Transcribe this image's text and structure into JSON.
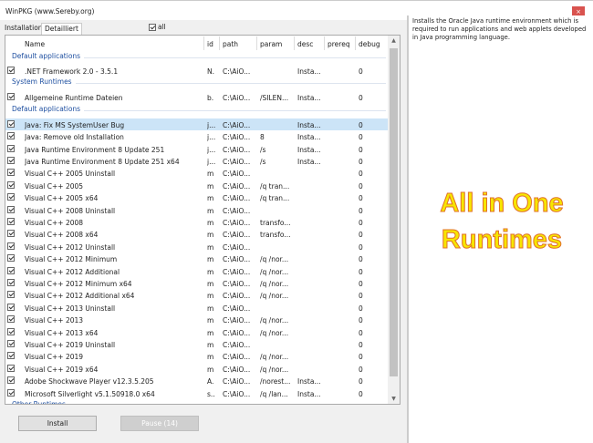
{
  "window": {
    "title": "WinPKG (www.Sereby.org)",
    "close": "×"
  },
  "tabs": [
    {
      "label": "Installation",
      "active": false
    },
    {
      "label": "Detailliert",
      "active": true
    }
  ],
  "all_checkbox": {
    "label": "all",
    "checked": true
  },
  "columns": [
    "Name",
    "id",
    "path",
    "param",
    "desc",
    "prereq",
    "debug"
  ],
  "items": [
    {
      "group": "Default applications"
    },
    {
      "name": ".NET Framework 2.0 - 3.5.1",
      "id": "N.",
      "path": "C:\\AiO...",
      "param": "",
      "desc": "Insta...",
      "prereq": "",
      "debug": "0"
    },
    {
      "group": "System Runtimes"
    },
    {
      "name": "Allgemeine Runtime Dateien",
      "id": "b.",
      "path": "C:\\AiO...",
      "param": "/SILEN...",
      "desc": "Insta...",
      "prereq": "",
      "debug": "0"
    },
    {
      "group": "Default applications"
    },
    {
      "name": "Java: Fix MS SystemUser Bug",
      "id": "j...",
      "path": "C:\\AiO...",
      "param": "",
      "desc": "Insta...",
      "prereq": "",
      "debug": "0",
      "selected": true
    },
    {
      "name": "Java: Remove old Installation",
      "id": "j...",
      "path": "C:\\AiO...",
      "param": "8",
      "desc": "Insta...",
      "prereq": "",
      "debug": "0"
    },
    {
      "name": "Java Runtime Environment 8 Update 251",
      "id": "j...",
      "path": "C:\\AiO...",
      "param": "/s",
      "desc": "Insta...",
      "prereq": "",
      "debug": "0"
    },
    {
      "name": "Java Runtime Environment 8 Update 251 x64",
      "id": "j...",
      "path": "C:\\AiO...",
      "param": "/s",
      "desc": "Insta...",
      "prereq": "",
      "debug": "0"
    },
    {
      "name": "Visual C++ 2005 Uninstall",
      "id": "m",
      "path": "C:\\AiO...",
      "param": "",
      "desc": "",
      "prereq": "",
      "debug": "0"
    },
    {
      "name": "Visual C++ 2005",
      "id": "m",
      "path": "C:\\AiO...",
      "param": "/q tran...",
      "desc": "",
      "prereq": "",
      "debug": "0"
    },
    {
      "name": "Visual C++ 2005 x64",
      "id": "m",
      "path": "C:\\AiO...",
      "param": "/q tran...",
      "desc": "",
      "prereq": "",
      "debug": "0"
    },
    {
      "name": "Visual C++ 2008 Uninstall",
      "id": "m",
      "path": "C:\\AiO...",
      "param": "",
      "desc": "",
      "prereq": "",
      "debug": "0"
    },
    {
      "name": "Visual C++ 2008",
      "id": "m",
      "path": "C:\\AiO...",
      "param": "transfo...",
      "desc": "",
      "prereq": "",
      "debug": "0"
    },
    {
      "name": "Visual C++ 2008 x64",
      "id": "m",
      "path": "C:\\AiO...",
      "param": "transfo...",
      "desc": "",
      "prereq": "",
      "debug": "0"
    },
    {
      "name": "Visual C++ 2012 Uninstall",
      "id": "m",
      "path": "C:\\AiO...",
      "param": "",
      "desc": "",
      "prereq": "",
      "debug": "0"
    },
    {
      "name": "Visual C++ 2012 Minimum",
      "id": "m",
      "path": "C:\\AiO...",
      "param": "/q /nor...",
      "desc": "",
      "prereq": "",
      "debug": "0"
    },
    {
      "name": "Visual C++ 2012 Additional",
      "id": "m",
      "path": "C:\\AiO...",
      "param": "/q /nor...",
      "desc": "",
      "prereq": "",
      "debug": "0"
    },
    {
      "name": "Visual C++ 2012 Minimum x64",
      "id": "m",
      "path": "C:\\AiO...",
      "param": "/q /nor...",
      "desc": "",
      "prereq": "",
      "debug": "0"
    },
    {
      "name": "Visual C++ 2012 Additional x64",
      "id": "m",
      "path": "C:\\AiO...",
      "param": "/q /nor...",
      "desc": "",
      "prereq": "",
      "debug": "0"
    },
    {
      "name": "Visual C++ 2013 Uninstall",
      "id": "m",
      "path": "C:\\AiO...",
      "param": "",
      "desc": "",
      "prereq": "",
      "debug": "0"
    },
    {
      "name": "Visual C++ 2013",
      "id": "m",
      "path": "C:\\AiO...",
      "param": "/q /nor...",
      "desc": "",
      "prereq": "",
      "debug": "0"
    },
    {
      "name": "Visual C++ 2013 x64",
      "id": "m",
      "path": "C:\\AiO...",
      "param": "/q /nor...",
      "desc": "",
      "prereq": "",
      "debug": "0"
    },
    {
      "name": "Visual C++ 2019 Uninstall",
      "id": "m",
      "path": "C:\\AiO...",
      "param": "",
      "desc": "",
      "prereq": "",
      "debug": "0"
    },
    {
      "name": "Visual C++ 2019",
      "id": "m",
      "path": "C:\\AiO...",
      "param": "/q /nor...",
      "desc": "",
      "prereq": "",
      "debug": "0"
    },
    {
      "name": "Visual C++ 2019 x64",
      "id": "m",
      "path": "C:\\AiO...",
      "param": "/q /nor...",
      "desc": "",
      "prereq": "",
      "debug": "0"
    },
    {
      "name": "Adobe Shockwave Player v12.3.5.205",
      "id": "A.",
      "path": "C:\\AiO...",
      "param": "/norest...",
      "desc": "Insta...",
      "prereq": "",
      "debug": "0"
    },
    {
      "name": "Microsoft Silverlight v5.1.50918.0 x64",
      "id": "s..",
      "path": "C:\\AiO...",
      "param": "/q /lan...",
      "desc": "Insta...",
      "prereq": "",
      "debug": "0"
    },
    {
      "group": "Other Runtimes"
    }
  ],
  "buttons": {
    "install": "Install",
    "pause": "Pause (14)"
  },
  "description": "Installs the Oracle Java runtime environment which is required to run applications and web applets developed in Java programming language.",
  "overlay": {
    "line1": "All in One",
    "line2": "Runtimes"
  },
  "colors": {
    "selected_row": "#cce4f7",
    "group_header": "#1e4fa0",
    "close_button": "#d9534f",
    "overlay_fill": "#f7e600",
    "overlay_outline": "#e0702a"
  }
}
